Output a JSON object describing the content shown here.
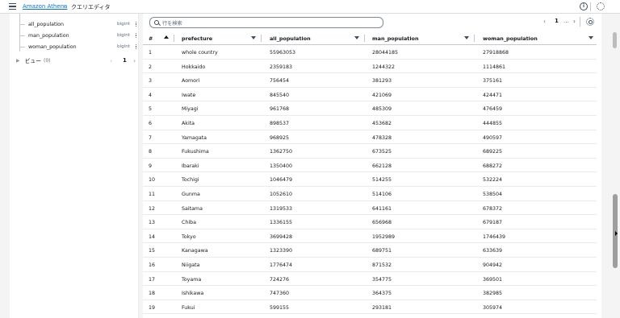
{
  "header": {
    "breadcrumb_link": "Amazon Athena",
    "breadcrumb_sep": "›",
    "breadcrumb_current": "クエリエディタ",
    "info_icon": "i",
    "settings_icon_glyph": "⚙"
  },
  "sidebar": {
    "columns": [
      {
        "name": "all_population",
        "type": "bigint"
      },
      {
        "name": "man_population",
        "type": "bigint"
      },
      {
        "name": "woman_population",
        "type": "bigint"
      }
    ],
    "views": {
      "caret": "▶",
      "label": "ビュー",
      "count": "(0)",
      "prev": "‹",
      "page": "1",
      "next": "›"
    }
  },
  "results": {
    "search_placeholder": "行を検索",
    "pager": {
      "prev": "‹",
      "page": "1",
      "ellipsis": "...",
      "next": "›"
    },
    "columns": [
      "#",
      "prefecture",
      "all_population",
      "man_population",
      "woman_population"
    ],
    "rows": [
      [
        "1",
        "whole country",
        "55963053",
        "28044185",
        "27918868"
      ],
      [
        "2",
        "Hokkaido",
        "2359183",
        "1244322",
        "1114861"
      ],
      [
        "3",
        "Aomori",
        "756454",
        "381293",
        "375161"
      ],
      [
        "4",
        "Iwate",
        "845540",
        "421069",
        "424471"
      ],
      [
        "5",
        "Miyagi",
        "961768",
        "485309",
        "476459"
      ],
      [
        "6",
        "Akita",
        "898537",
        "453682",
        "444855"
      ],
      [
        "7",
        "Yamagata",
        "968925",
        "478328",
        "490597"
      ],
      [
        "8",
        "Fukushima",
        "1362750",
        "673525",
        "689225"
      ],
      [
        "9",
        "Ibaraki",
        "1350400",
        "662128",
        "688272"
      ],
      [
        "10",
        "Tochigi",
        "1046479",
        "514255",
        "532224"
      ],
      [
        "11",
        "Gunma",
        "1052610",
        "514106",
        "538504"
      ],
      [
        "12",
        "Saitama",
        "1319533",
        "641161",
        "678372"
      ],
      [
        "13",
        "Chiba",
        "1336155",
        "656968",
        "679187"
      ],
      [
        "14",
        "Tokyo",
        "3699428",
        "1952989",
        "1746439"
      ],
      [
        "15",
        "Kanagawa",
        "1323390",
        "689751",
        "633639"
      ],
      [
        "16",
        "Niigata",
        "1776474",
        "871532",
        "904942"
      ],
      [
        "17",
        "Toyama",
        "724276",
        "354775",
        "369501"
      ],
      [
        "18",
        "Ishikawa",
        "747360",
        "364375",
        "382985"
      ],
      [
        "19",
        "Fukui",
        "599155",
        "293181",
        "305974"
      ]
    ]
  },
  "colors": {
    "link": "#0972d3",
    "text": "#16191f",
    "muted": "#5f6b7a",
    "border": "#e9ebed"
  }
}
